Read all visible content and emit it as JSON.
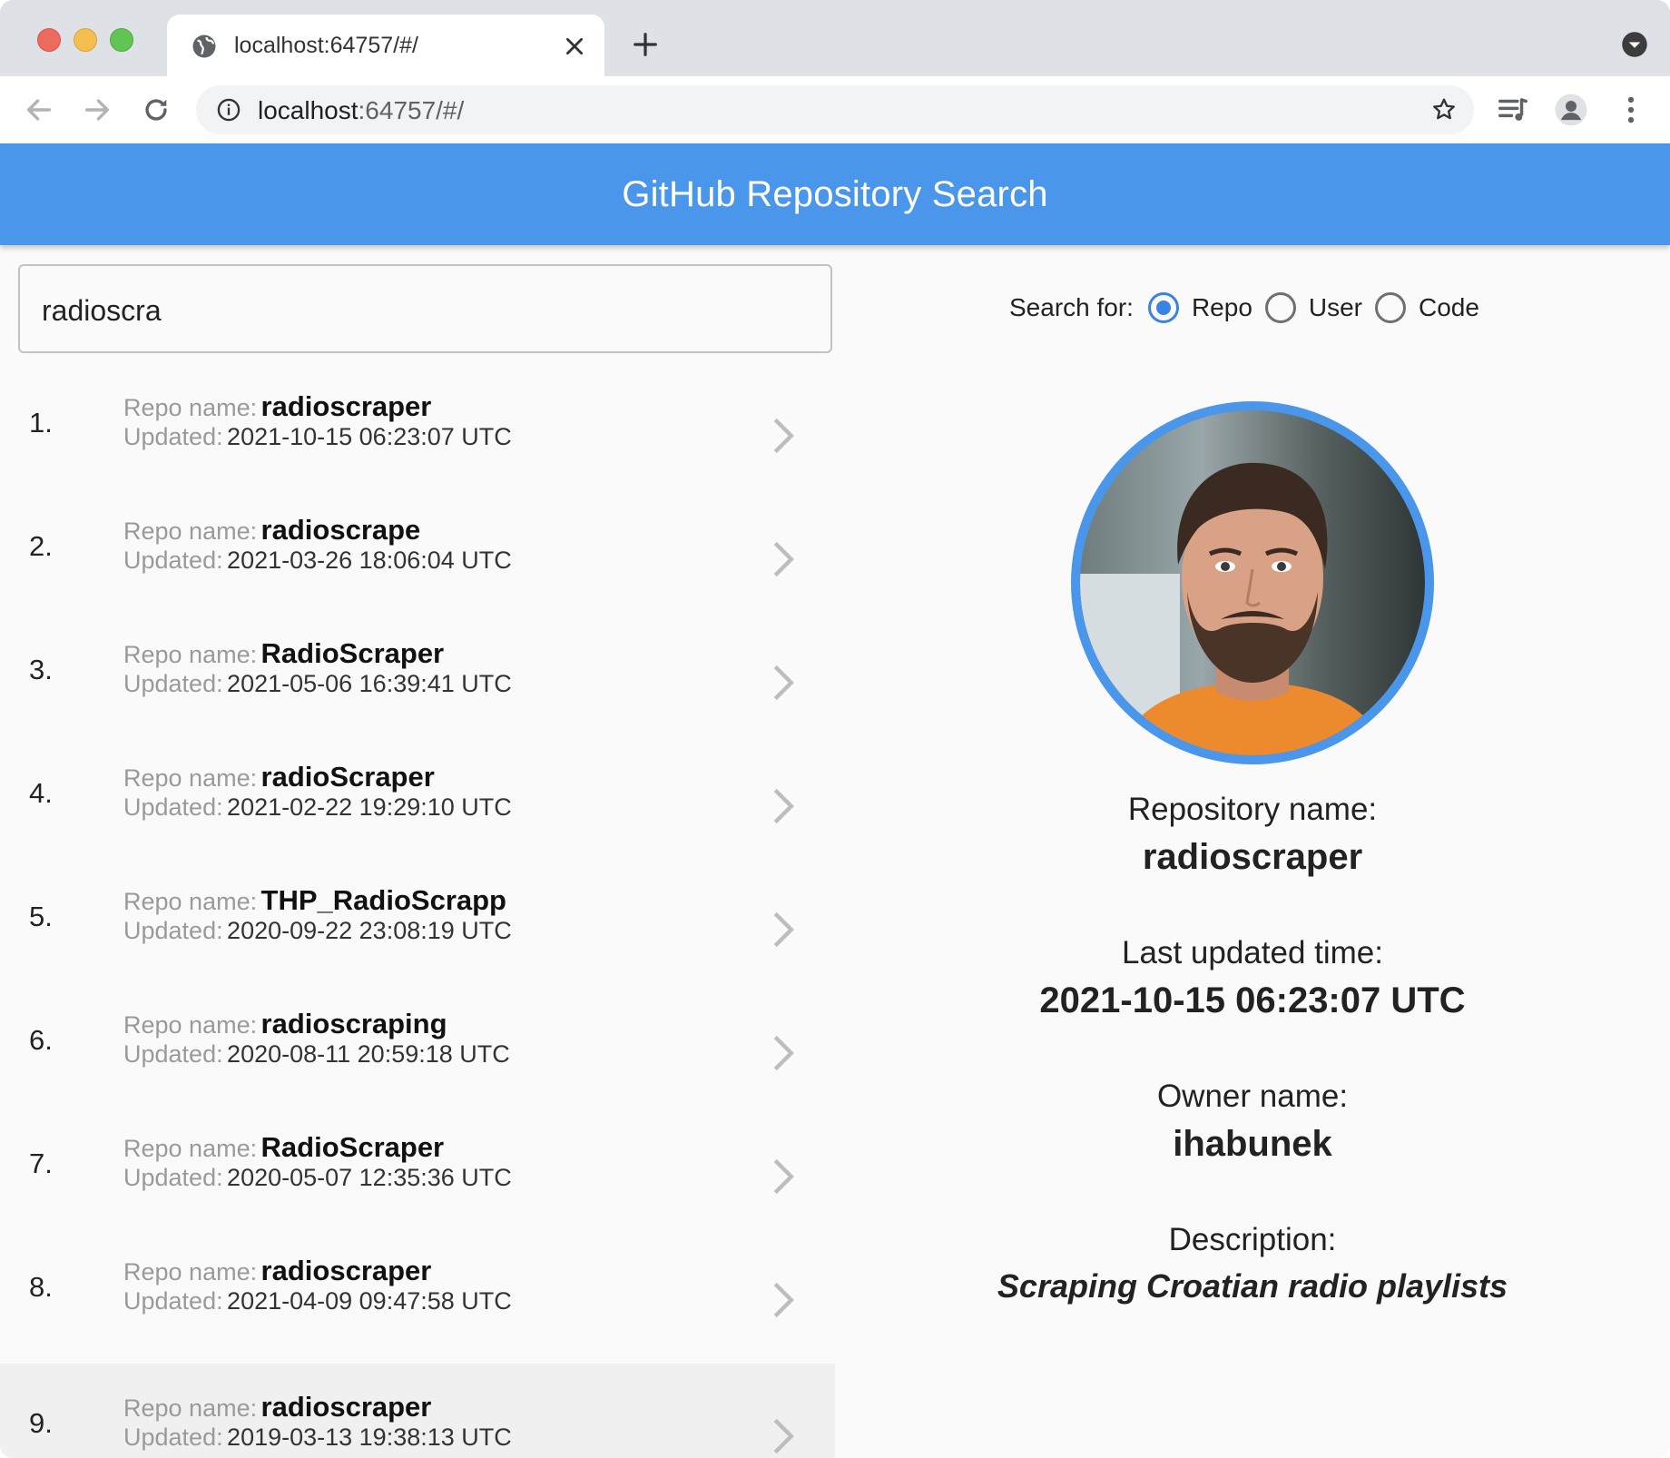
{
  "browser": {
    "tab_title": "localhost:64757/#/",
    "url_host": "localhost",
    "url_rest": ":64757/#/"
  },
  "appbar": {
    "title": "GitHub Repository Search"
  },
  "search": {
    "value": "radioscra"
  },
  "search_for": {
    "label": "Search for:",
    "options": [
      {
        "label": "Repo",
        "selected": true
      },
      {
        "label": "User",
        "selected": false
      },
      {
        "label": "Code",
        "selected": false
      }
    ]
  },
  "results": {
    "name_label": "Repo name:",
    "updated_label": "Updated:",
    "items": [
      {
        "num": "1.",
        "name": "radioscraper",
        "updated": "2021-10-15 06:23:07 UTC"
      },
      {
        "num": "2.",
        "name": "radioscrape",
        "updated": "2021-03-26 18:06:04 UTC"
      },
      {
        "num": "3.",
        "name": "RadioScraper",
        "updated": "2021-05-06 16:39:41 UTC"
      },
      {
        "num": "4.",
        "name": "radioScraper",
        "updated": "2021-02-22 19:29:10 UTC"
      },
      {
        "num": "5.",
        "name": "THP_RadioScrapp",
        "updated": "2020-09-22 23:08:19 UTC"
      },
      {
        "num": "6.",
        "name": "radioscraping",
        "updated": "2020-08-11 20:59:18 UTC"
      },
      {
        "num": "7.",
        "name": "RadioScraper",
        "updated": "2020-05-07 12:35:36 UTC"
      },
      {
        "num": "8.",
        "name": "radioscraper",
        "updated": "2021-04-09 09:47:58 UTC"
      },
      {
        "num": "9.",
        "name": "radioscraper",
        "updated": "2019-03-13 19:38:13 UTC"
      }
    ]
  },
  "details": {
    "repo_label": "Repository name:",
    "repo_value": "radioscraper",
    "updated_label": "Last updated time:",
    "updated_value": "2021-10-15 06:23:07 UTC",
    "owner_label": "Owner name:",
    "owner_value": "ihabunek",
    "desc_label": "Description:",
    "desc_value": "Scraping Croatian radio playlists"
  },
  "colors": {
    "appbar": "#4a96ea",
    "accent": "#3b82e6"
  }
}
